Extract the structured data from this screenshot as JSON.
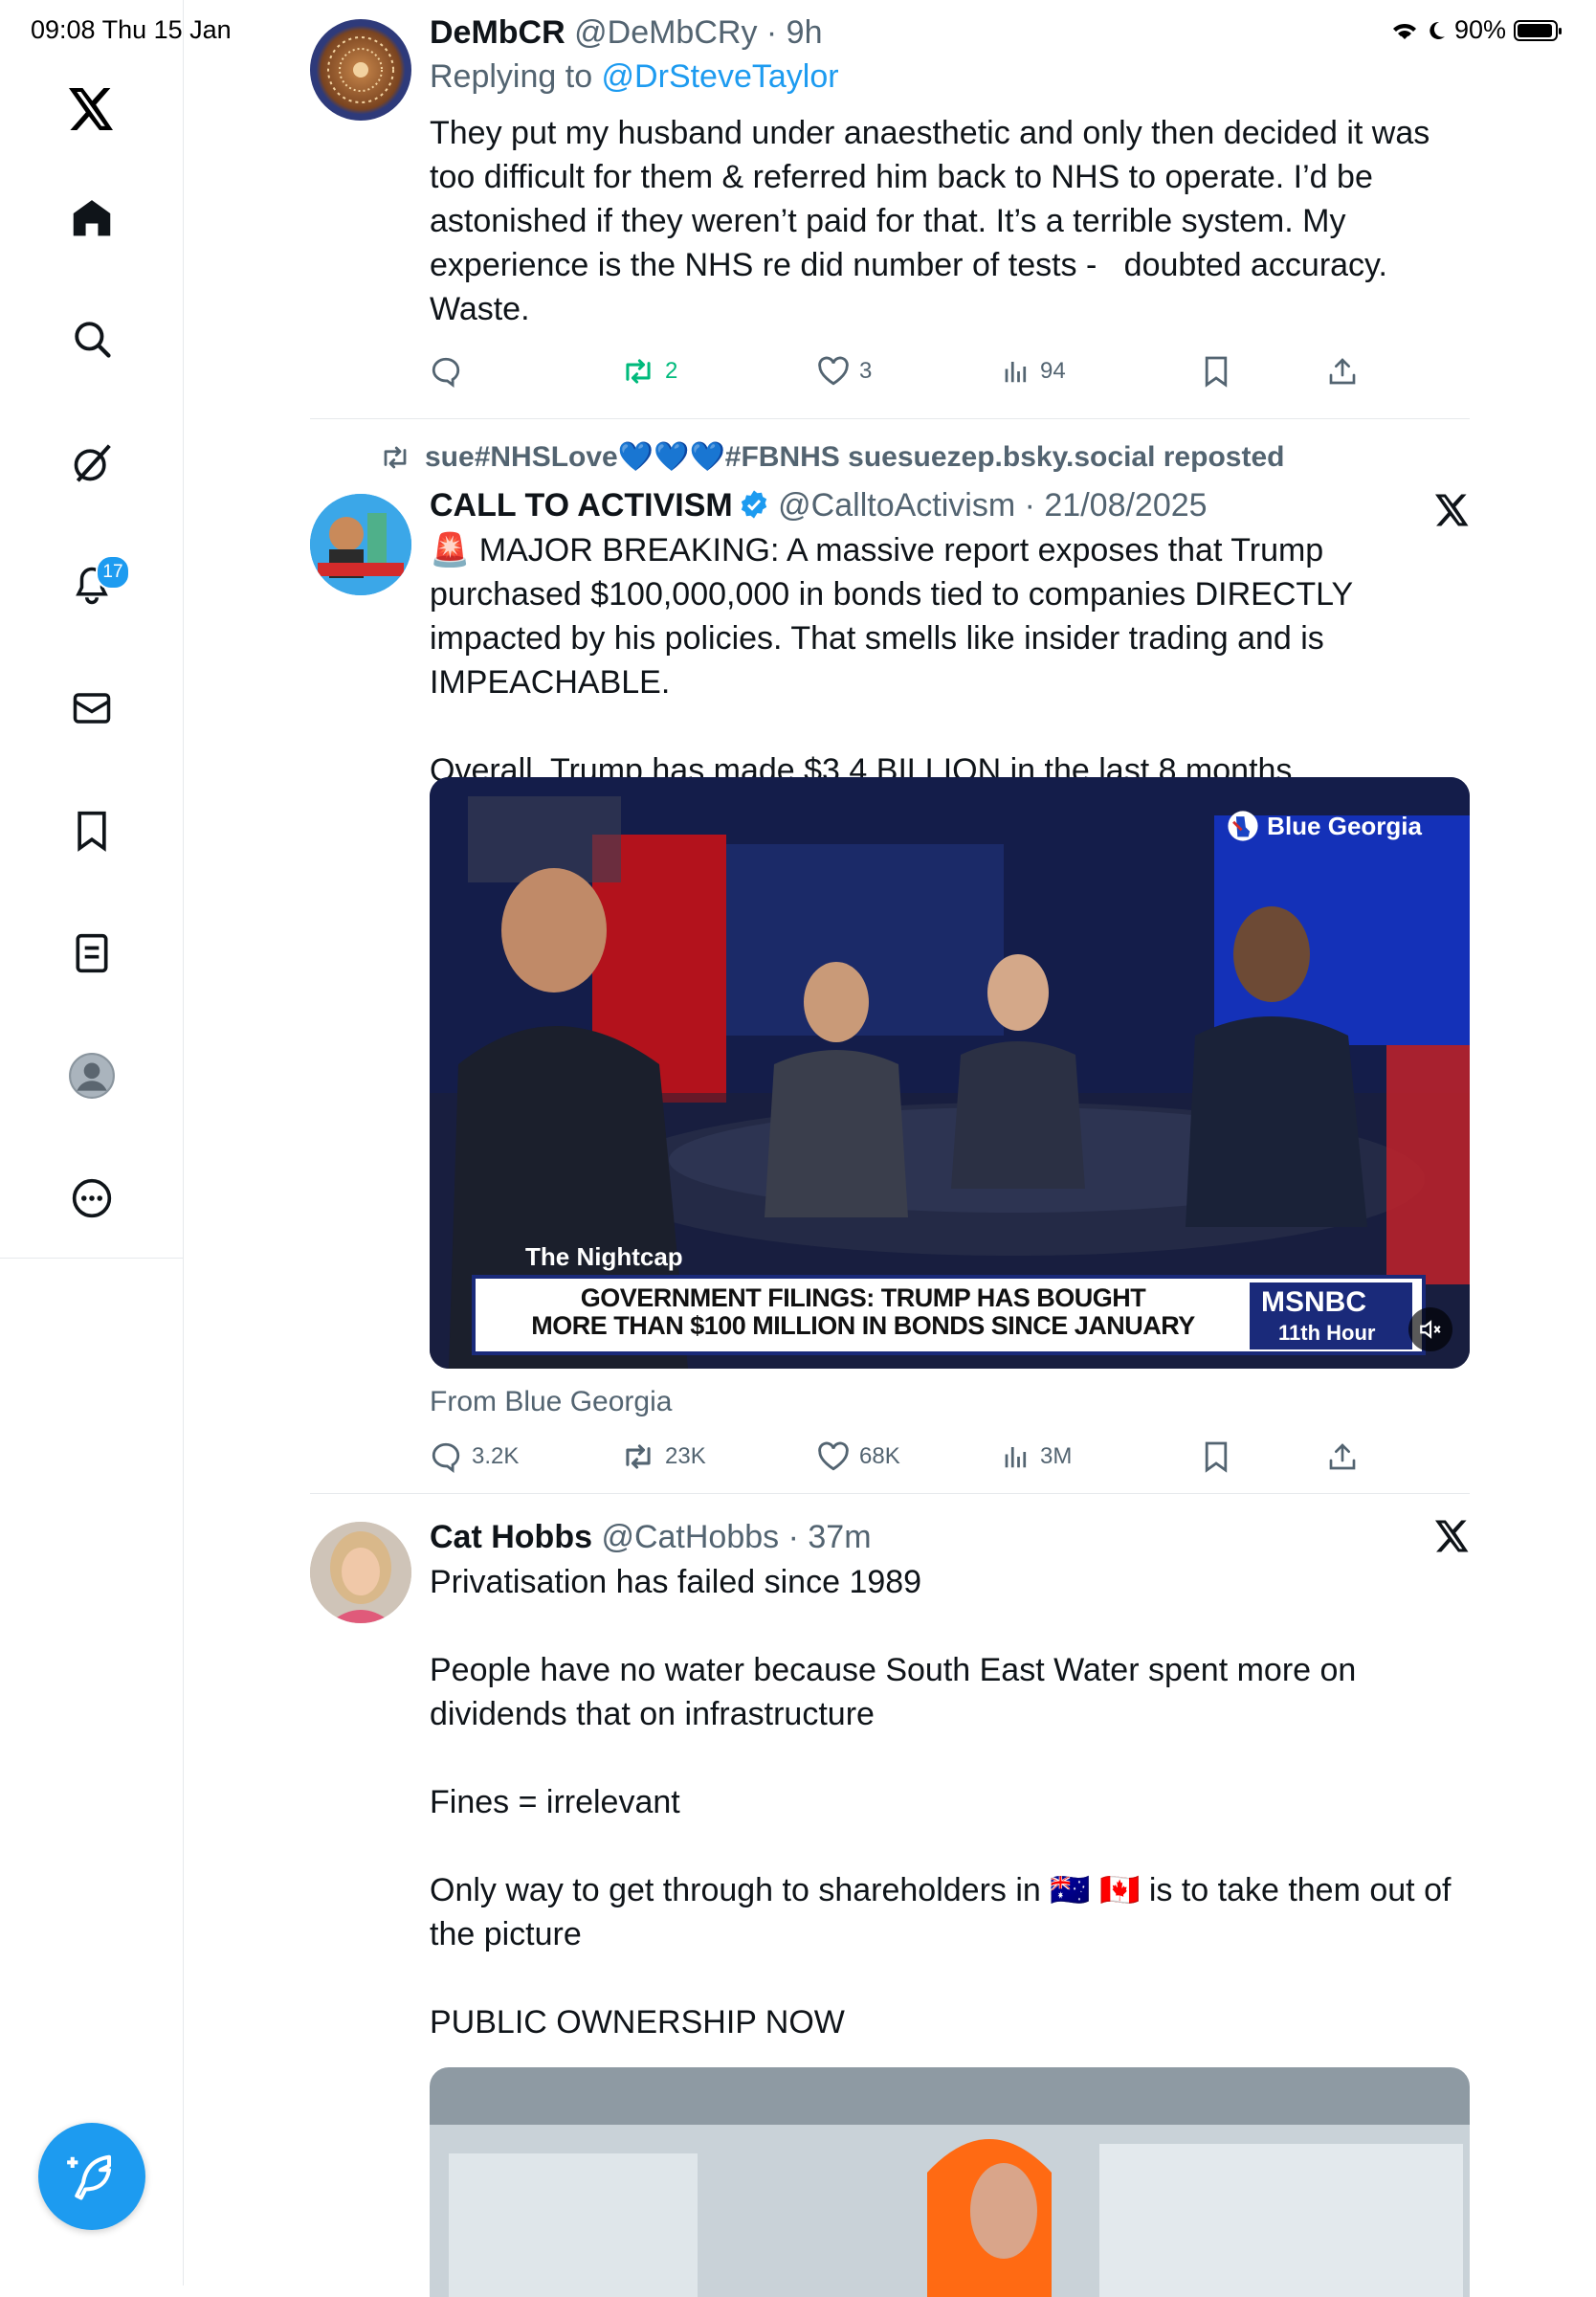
{
  "status_bar": {
    "time_date": "09:08   Thu 15 Jan",
    "battery": "90%"
  },
  "sidebar": {
    "items": [
      {
        "name": "home",
        "label": "Home"
      },
      {
        "name": "explore",
        "label": "Explore"
      },
      {
        "name": "grok",
        "label": "Grok"
      },
      {
        "name": "notifications",
        "label": "Notifications",
        "badge": "17"
      },
      {
        "name": "messages",
        "label": "Messages"
      },
      {
        "name": "bookmarks",
        "label": "Bookmarks"
      },
      {
        "name": "lists",
        "label": "Lists"
      },
      {
        "name": "profile",
        "label": "Profile"
      },
      {
        "name": "more",
        "label": "More"
      }
    ]
  },
  "tweets": [
    {
      "name": "DeMbCR",
      "handle": "@DeMbCRy",
      "time": "· 9h",
      "replying_prefix": "Replying to ",
      "replying_to": "@DrSteveTaylor",
      "text": "They put my husband under anaesthetic and only then decided it was too difficult for them & referred him back to NHS to operate. I’d be astonished if they weren’t paid for that. It’s a terrible system. My experience is the NHS re did number of tests -   doubted accuracy. Waste.",
      "stats": {
        "replies": "",
        "reposts": "2",
        "likes": "3",
        "views": "94"
      }
    },
    {
      "repost_by": "sue#NHSLove💙💙💙#FBNHS suesuezep.bsky.social reposted",
      "name": "CALL TO ACTIVISM",
      "handle": "@CalltoActivism",
      "time": "· 21/08/2025",
      "text": "🚨 MAJOR BREAKING: A massive report exposes that Trump purchased $100,000,000 in bonds tied to companies DIRECTLY impacted by his policies. That smells like insider trading and is IMPEACHABLE.\n\nOverall, Trump has made $3.4 BILLION in the last 8 months.",
      "video": {
        "source_tag": "Blue Georgia",
        "show": "The Nightcap",
        "headline_1": "GOVERNMENT FILINGS: TRUMP HAS BOUGHT",
        "headline_2": "MORE THAN $100 MILLION IN BONDS SINCE JANUARY",
        "network": "MSNBC",
        "program": "11th Hour"
      },
      "from": "From Blue Georgia",
      "stats": {
        "replies": "3.2K",
        "reposts": "23K",
        "likes": "68K",
        "views": "3M"
      }
    },
    {
      "name": "Cat Hobbs",
      "handle": "@CatHobbs",
      "time": "· 37m",
      "text": "Privatisation has failed since 1989\n\nPeople have no water because South East Water spent more on dividends that on infrastructure\n\nFines = irrelevant\n\nOnly way to get through to shareholders in 🇦🇺 🇨🇦 is to take them out of the picture\n\nPUBLIC OWNERSHIP NOW"
    }
  ],
  "colors": {
    "accent": "#1d9bf0",
    "repost_green": "#00ba7c",
    "muted": "#536471"
  }
}
